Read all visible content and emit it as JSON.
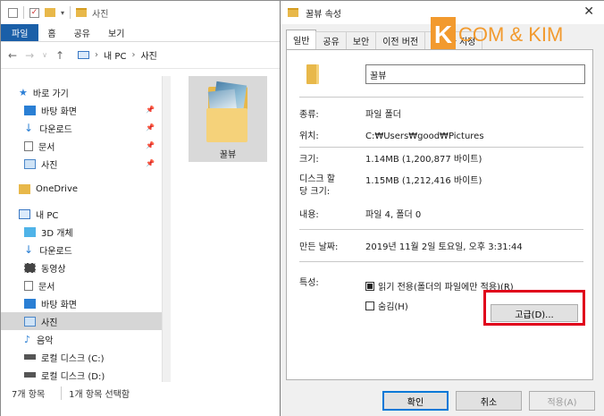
{
  "explorer": {
    "title": "사진",
    "ribbon_tabs": [
      "파일",
      "홈",
      "공유",
      "보기"
    ],
    "breadcrumb": [
      "내 PC",
      "사진"
    ],
    "sidebar": {
      "quick_access": "바로 가기",
      "quick_items": [
        "바탕 화면",
        "다운로드",
        "문서",
        "사진"
      ],
      "onedrive": "OneDrive",
      "this_pc": "내 PC",
      "pc_items": [
        "3D 개체",
        "다운로드",
        "동영상",
        "문서",
        "바탕 화면",
        "사진",
        "음악",
        "로컬 디스크 (C:)",
        "로컬 디스크 (D:)"
      ],
      "selected": "사진"
    },
    "folder_tile_label": "꿀뷰",
    "status": {
      "item_count": "7개 항목",
      "selected": "1개 항목 선택함"
    }
  },
  "dialog": {
    "title": "꿀뷰 속성",
    "tabs": [
      "일반",
      "공유",
      "보안",
      "이전 버전",
      "사용자 지정"
    ],
    "active_tab": "일반",
    "watermark": {
      "letter": "K",
      "text": "COM & KIM"
    },
    "folder_name": "꿀뷰",
    "props": {
      "type_label": "종류:",
      "type_value": "파일 폴더",
      "location_label": "위치:",
      "location_value": "C:₩Users₩good₩Pictures",
      "size_label": "크기:",
      "size_value": "1.14MB (1,200,877 바이트)",
      "disk_size_label": "디스크 할\n당 크기:",
      "disk_size_value": "1.15MB (1,212,416 바이트)",
      "contents_label": "내용:",
      "contents_value": "파일 4, 폴더 0",
      "created_label": "만든 날짜:",
      "created_value": "2019년 11월 2일 토요일, 오후 3:31:44",
      "attributes_label": "특성:",
      "readonly_label": "읽기 전용(폴더의 파일에만 적용)(R)",
      "hidden_label": "숨김(H)",
      "advanced_button": "고급(D)..."
    },
    "buttons": {
      "ok": "확인",
      "cancel": "취소",
      "apply": "적용(A)"
    }
  },
  "colors": {
    "ribbon_active": "#1a5fa8",
    "highlight_box": "#e0001b",
    "watermark": "#f29a2e",
    "folder": "#e8b84a"
  }
}
